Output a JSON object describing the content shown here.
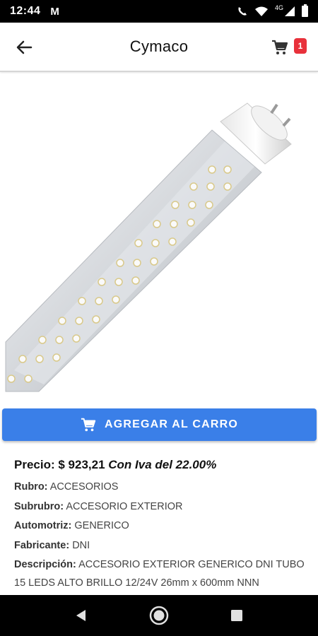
{
  "status_bar": {
    "time": "12:44",
    "gmail_glyph": "M",
    "network": "4G"
  },
  "app_bar": {
    "title": "Cymaco",
    "cart_count": "1"
  },
  "product": {
    "image_icon": "led-tube-image",
    "add_to_cart_label": "AGREGAR AL CARRO",
    "price_label": "Precio: $ 923,21",
    "price_tax_note": "Con Iva del 22.00%",
    "fields": [
      {
        "label": "Rubro:",
        "value": "ACCESORIOS"
      },
      {
        "label": "Subrubro:",
        "value": "ACCESORIO EXTERIOR"
      },
      {
        "label": "Automotriz:",
        "value": "GENERICO"
      },
      {
        "label": "Fabricante:",
        "value": "DNI"
      }
    ],
    "description_label": "Descripción:",
    "description_value": "ACCESORIO EXTERIOR GENERICO DNI TUBO 15 LEDS ALTO BRILLO 12/24V 26mm x 600mm NNN"
  },
  "colors": {
    "primary": "#3a7fe8",
    "badge": "#e8313b"
  }
}
